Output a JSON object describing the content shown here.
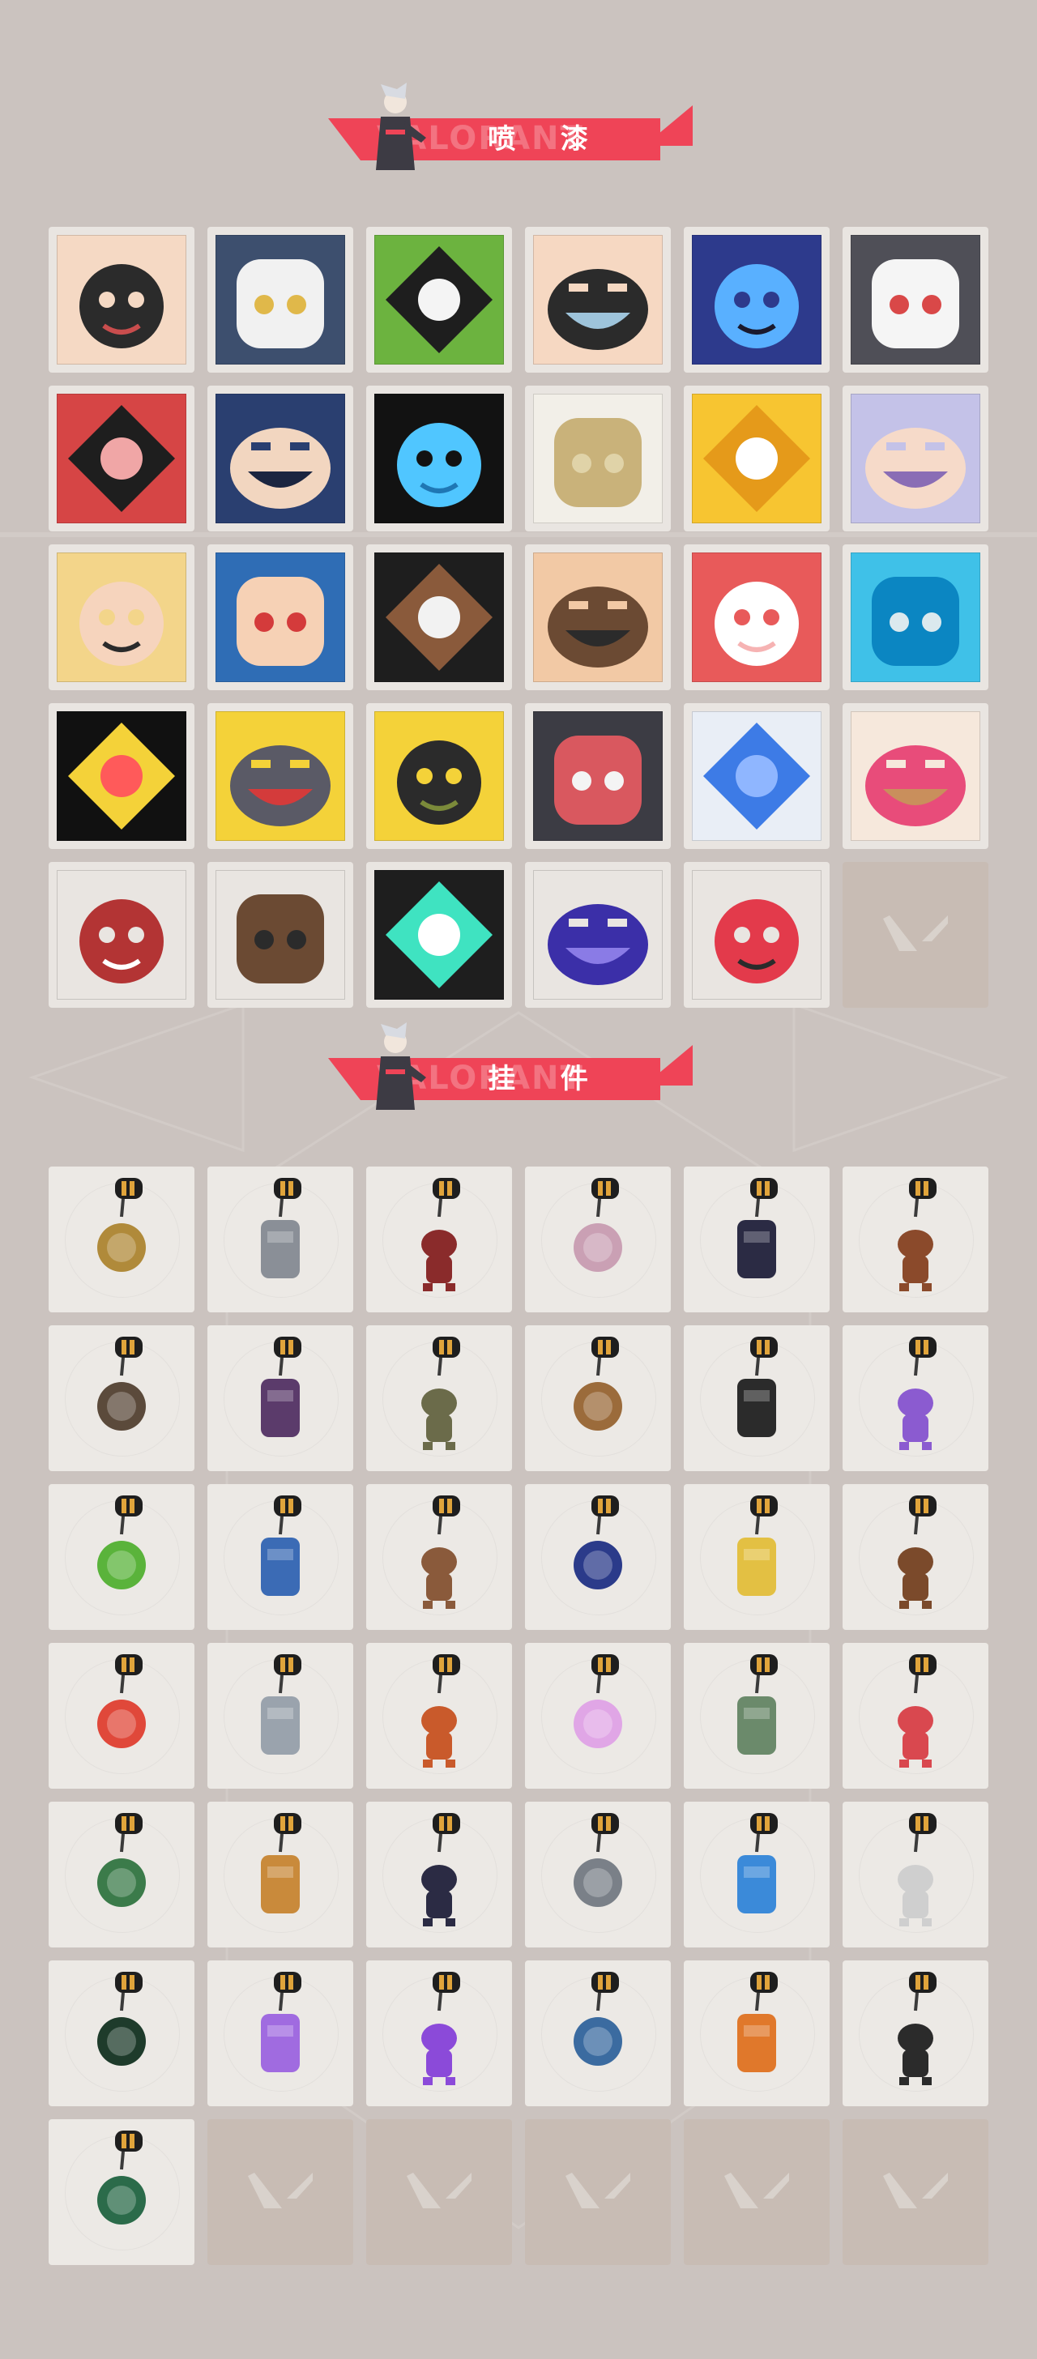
{
  "sections": {
    "sprays": {
      "title": "喷 漆",
      "watermark": "VALORANT",
      "mascot_icon": "agent-mascot-icon"
    },
    "buddies": {
      "title": "挂 件",
      "watermark": "VALORANT",
      "mascot_icon": "agent-mascot-icon"
    }
  },
  "colors": {
    "background": "#cbc3bf",
    "banner_red": "#ef4457",
    "tile_light": "#e9e5e1",
    "tile_empty": "#c8bcb4"
  },
  "sprays": [
    {
      "icon": "girl-pencil-spray-icon"
    },
    {
      "icon": "penguin-beanie-spray-icon"
    },
    {
      "icon": "frog-tophat-spray-icon"
    },
    {
      "icon": "smug-face-spray-icon"
    },
    {
      "icon": "dark-agent-spray-icon"
    },
    {
      "icon": "gray-cat-laugh-spray-icon"
    },
    {
      "icon": "red-blob-spray-icon"
    },
    {
      "icon": "hooded-agent-spray-icon"
    },
    {
      "icon": "blue-claw-spray-icon"
    },
    {
      "icon": "gold-vct-logo-spray-icon"
    },
    {
      "icon": "star-spray-icon"
    },
    {
      "icon": "wink-girl-spray-icon"
    },
    {
      "icon": "blonde-agent-spray-icon"
    },
    {
      "icon": "grinning-agent-spray-icon"
    },
    {
      "icon": "sunglasses-agent-spray-icon"
    },
    {
      "icon": "bearded-agent-spray-icon"
    },
    {
      "icon": "ii0-text-spray-icon"
    },
    {
      "icon": "blue-orb-spray-icon"
    },
    {
      "icon": "yellow-creature-spray-icon"
    },
    {
      "icon": "bandana-cat-spray-icon"
    },
    {
      "icon": "grenade-hands-spray-icon"
    },
    {
      "icon": "screaming-cat-spray-icon"
    },
    {
      "icon": "neon-star-spray-icon"
    },
    {
      "icon": "heart-hands-spray-icon"
    },
    {
      "icon": "red-x-button-spray-icon"
    },
    {
      "icon": "pixel-raccoon-spray-icon"
    },
    {
      "icon": "valorant-splash-logo-spray-icon"
    },
    {
      "icon": "graffiti-tag-spray-icon"
    },
    {
      "icon": "red-valorant-logo-spray-icon"
    },
    {
      "icon": "empty-slot-icon",
      "empty": true
    }
  ],
  "buddies": [
    {
      "icon": "gold-bear-buddy-icon"
    },
    {
      "icon": "ramen-cart-buddy-icon"
    },
    {
      "icon": "rope-chain-buddy-icon"
    },
    {
      "icon": "cupcake-buddy-icon"
    },
    {
      "icon": "ep9-disc-buddy-icon"
    },
    {
      "icon": "boxer-bear-buddy-icon"
    },
    {
      "icon": "gun-block-buddy-icon"
    },
    {
      "icon": "agent-figure-buddy-icon"
    },
    {
      "icon": "cowboy-bot-buddy-icon"
    },
    {
      "icon": "cardboard-box-buddy-icon"
    },
    {
      "icon": "gramophone-buddy-icon"
    },
    {
      "icon": "lava-lamp-buddy-icon"
    },
    {
      "icon": "green-phone-buddy-icon"
    },
    {
      "icon": "blue-astronaut-buddy-icon"
    },
    {
      "icon": "radio-device-buddy-icon"
    },
    {
      "icon": "ep9-blue-disc-buddy-icon"
    },
    {
      "icon": "cheese-banana-buddy-icon"
    },
    {
      "icon": "brown-figure-buddy-icon"
    },
    {
      "icon": "fruit-skewer-buddy-icon"
    },
    {
      "icon": "silver-agent-buddy-icon"
    },
    {
      "icon": "hot-air-balloon-buddy-icon"
    },
    {
      "icon": "pink-hair-girl-buddy-icon"
    },
    {
      "icon": "robot-boxer-buddy-icon"
    },
    {
      "icon": "watermelon-buddy-icon"
    },
    {
      "icon": "green-bottle-buddy-icon"
    },
    {
      "icon": "honey-pot-buddy-icon"
    },
    {
      "icon": "ep9-gold-disc-buddy-icon"
    },
    {
      "icon": "silver-hook-buddy-icon"
    },
    {
      "icon": "blue-sword-buddy-icon"
    },
    {
      "icon": "faded-ep9-badge-buddy-icon"
    },
    {
      "icon": "ep9-green-disc-buddy-icon"
    },
    {
      "icon": "jellyfish-buddy-icon"
    },
    {
      "icon": "lotus-flame-buddy-icon"
    },
    {
      "icon": "ufo-buddy-icon"
    },
    {
      "icon": "orange-cat-buddy-icon"
    },
    {
      "icon": "valorant-disc-buddy-icon"
    },
    {
      "icon": "green-gem-buddy-icon"
    },
    {
      "icon": "empty-slot-icon",
      "empty": true
    },
    {
      "icon": "empty-slot-icon",
      "empty": true
    },
    {
      "icon": "empty-slot-icon",
      "empty": true
    },
    {
      "icon": "empty-slot-icon",
      "empty": true
    },
    {
      "icon": "empty-slot-icon",
      "empty": true
    }
  ]
}
